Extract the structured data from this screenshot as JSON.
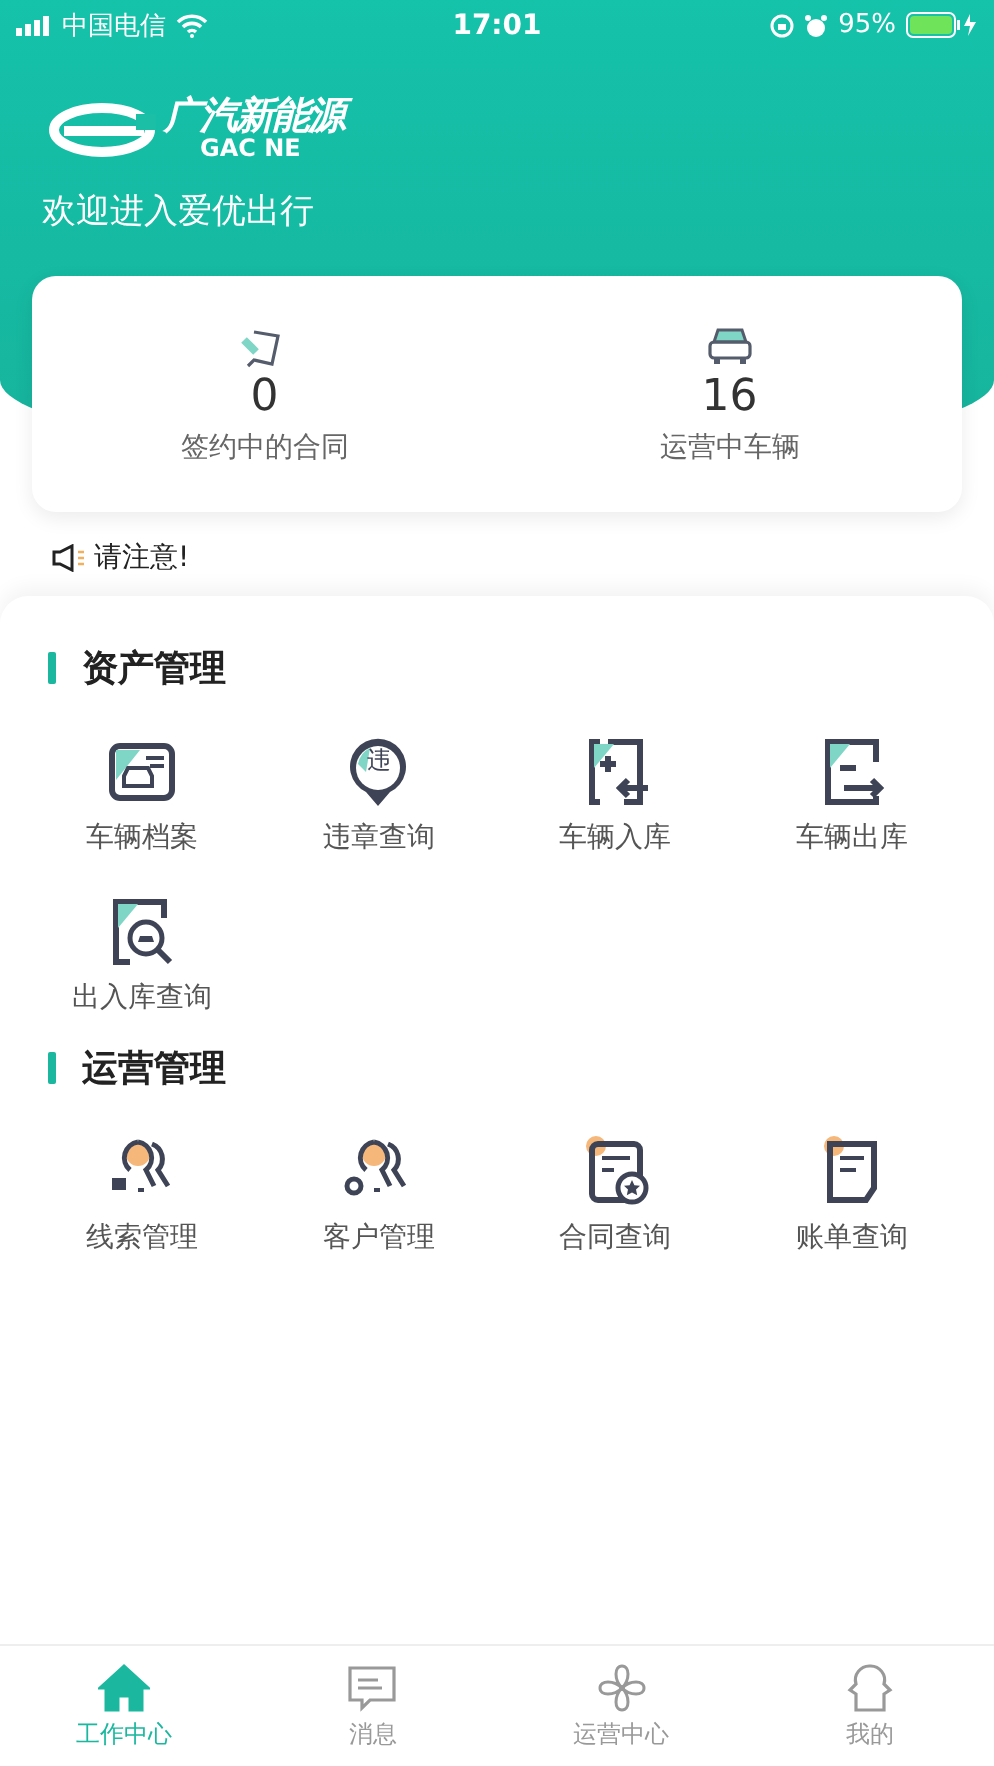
{
  "status_bar": {
    "carrier": "中国电信",
    "time": "17:01",
    "battery": "95%"
  },
  "header": {
    "logo_cn": "广汽新能源",
    "logo_en": "GAC NE",
    "welcome": "欢迎进入爱优出行"
  },
  "stats": [
    {
      "kind": "contract",
      "value": "0",
      "label": "签约中的合同"
    },
    {
      "kind": "car",
      "value": "16",
      "label": "运营中车辆"
    }
  ],
  "notice": "请注意!",
  "sections": [
    {
      "title": "资产管理",
      "items": [
        {
          "kind": "archive",
          "label": "车辆档案"
        },
        {
          "kind": "violation",
          "glyph": "违",
          "label": "违章查询"
        },
        {
          "kind": "stock_in",
          "label": "车辆入库"
        },
        {
          "kind": "stock_out",
          "label": "车辆出库"
        },
        {
          "kind": "stock_query",
          "label": "出入库查询"
        }
      ]
    },
    {
      "title": "运营管理",
      "items": [
        {
          "kind": "leads",
          "label": "线索管理"
        },
        {
          "kind": "customers",
          "label": "客户管理"
        },
        {
          "kind": "contract_query",
          "label": "合同查询"
        },
        {
          "kind": "bill",
          "label": "账单查询"
        }
      ]
    }
  ],
  "tab_bar": [
    {
      "kind": "home",
      "label": "工作中心",
      "selected": true
    },
    {
      "kind": "message",
      "label": "消息",
      "selected": false
    },
    {
      "kind": "operations",
      "label": "运营中心",
      "selected": false
    },
    {
      "kind": "profile",
      "label": "我的",
      "selected": false
    }
  ]
}
